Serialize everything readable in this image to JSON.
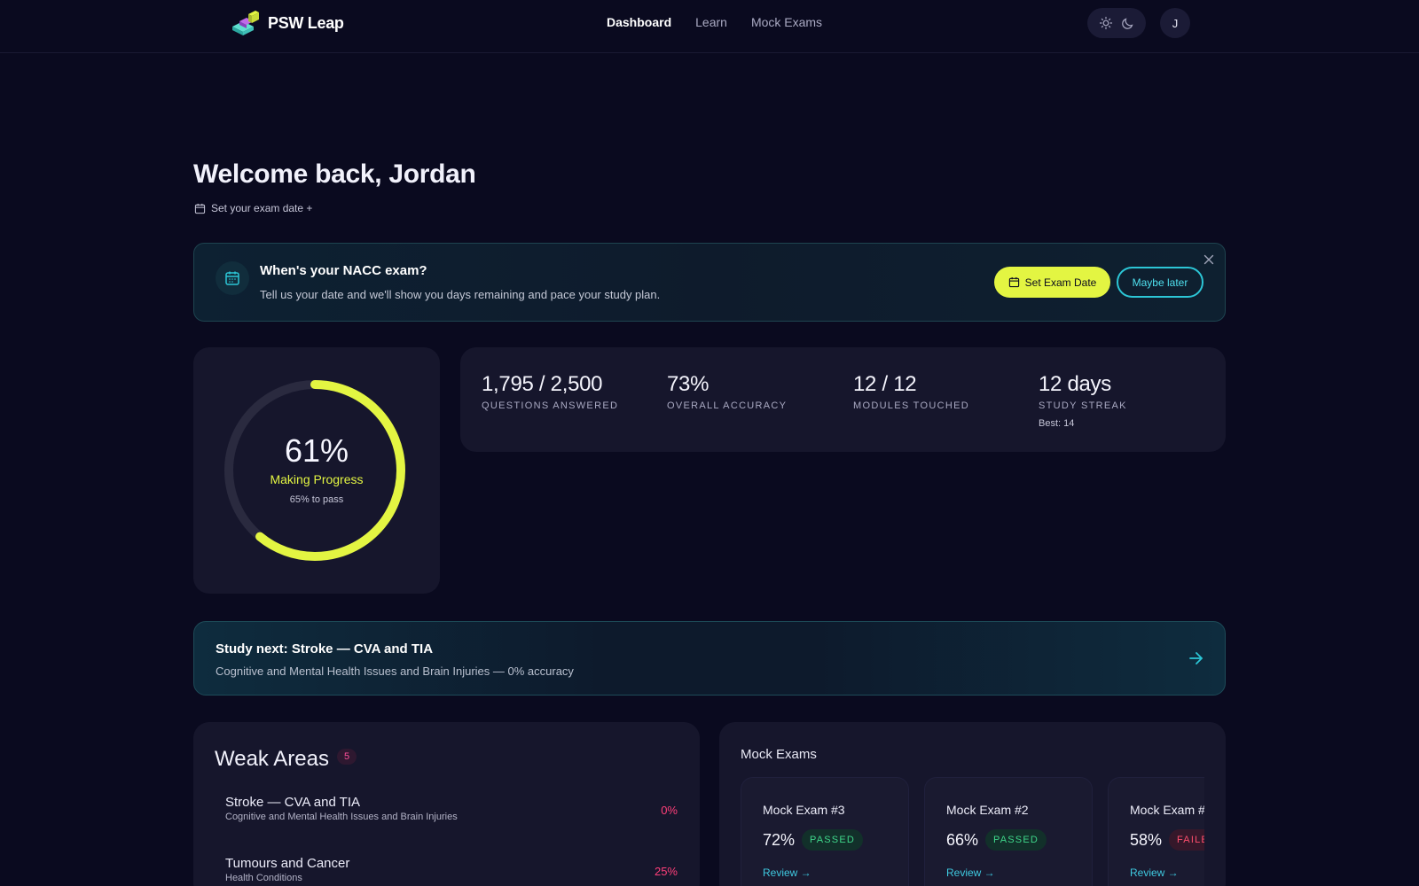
{
  "brand": {
    "name": "PSW Leap"
  },
  "nav": {
    "items": [
      "Dashboard",
      "Learn",
      "Mock Exams"
    ],
    "active": "Dashboard"
  },
  "user": {
    "initial": "J"
  },
  "header": {
    "welcome": "Welcome back, Jordan",
    "set_exam_link": "Set your exam date +"
  },
  "exam_banner": {
    "title": "When's your NACC exam?",
    "subtitle": "Tell us your date and we'll show you days remaining and pace your study plan.",
    "set_button": "Set Exam Date",
    "later_button": "Maybe later"
  },
  "progress": {
    "percent_label": "61%",
    "percent_value": 0.61,
    "status": "Making Progress",
    "pass_threshold": "65% to pass"
  },
  "stats": [
    {
      "value": "1,795 / 2,500",
      "label": "QUESTIONS ANSWERED"
    },
    {
      "value": "73%",
      "label": "OVERALL ACCURACY"
    },
    {
      "value": "12 / 12",
      "label": "MODULES TOUCHED"
    },
    {
      "value": "12 days",
      "label": "STUDY STREAK",
      "extra": "Best: 14"
    }
  ],
  "study_next": {
    "title": "Study next: Stroke — CVA and TIA",
    "subtitle": "Cognitive and Mental Health Issues and Brain Injuries — 0% accuracy"
  },
  "weak_areas": {
    "title": "Weak Areas",
    "count": "5",
    "items": [
      {
        "title": "Stroke — CVA and TIA",
        "subtitle": "Cognitive and Mental Health Issues and Brain Injuries",
        "percent": "0%"
      },
      {
        "title": "Tumours and Cancer",
        "subtitle": "Health Conditions",
        "percent": "25%"
      }
    ]
  },
  "mock_exams": {
    "title": "Mock Exams",
    "items": [
      {
        "name": "Mock Exam #3",
        "score": "72%",
        "status": "PASSED",
        "passed": true,
        "review": "Review →"
      },
      {
        "name": "Mock Exam #2",
        "score": "66%",
        "status": "PASSED",
        "passed": true,
        "review": "Review →"
      },
      {
        "name": "Mock Exam #",
        "score": "58%",
        "status": "FAILED",
        "passed": false,
        "review": "Review →"
      }
    ]
  },
  "colors": {
    "accent": "#e3f542",
    "teal": "#2cc6d6",
    "danger": "#ff3f7a",
    "pass": "#3fd68a",
    "background": "#0a0a1f"
  }
}
